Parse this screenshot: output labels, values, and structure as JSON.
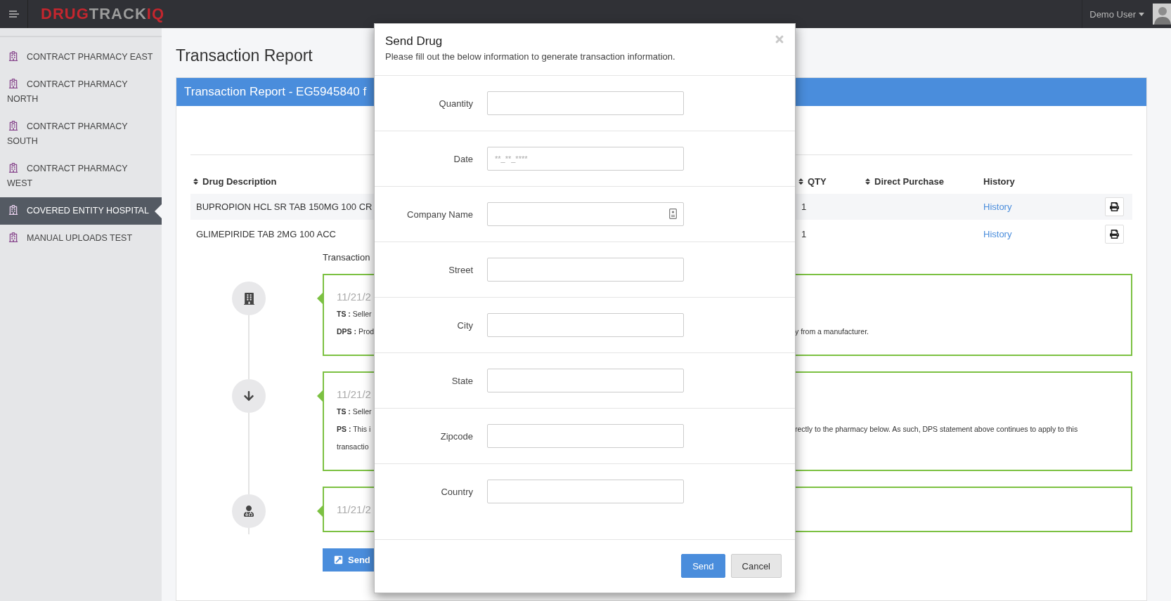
{
  "topbar": {
    "logo": [
      {
        "text": "DRUG",
        "color": "#c4262e"
      },
      {
        "text": "TRACK",
        "color": "#9b9b9b"
      },
      {
        "text": "IQ",
        "color": "#c4262e"
      }
    ],
    "user": "Demo User"
  },
  "sidebar": {
    "items": [
      {
        "label": "CONTRACT PHARMACY EAST",
        "selected": false
      },
      {
        "label": "CONTRACT PHARMACY NORTH",
        "selected": false
      },
      {
        "label": "CONTRACT PHARMACY SOUTH",
        "selected": false
      },
      {
        "label": "CONTRACT PHARMACY WEST",
        "selected": false
      },
      {
        "label": "COVERED ENTITY HOSPITAL",
        "selected": true
      },
      {
        "label": "MANUAL UPLOADS TEST",
        "selected": false
      }
    ]
  },
  "page": {
    "title": "Transaction Report",
    "panel_title": "Transaction Report - EG5945840 f"
  },
  "table": {
    "columns": [
      {
        "label": "Drug Description",
        "sortable": true
      },
      {
        "label": "QTY",
        "sortable": true
      },
      {
        "label": "Direct Purchase",
        "sortable": true
      },
      {
        "label": "History",
        "sortable": false
      }
    ],
    "rows": [
      {
        "drug": "BUPROPION HCL SR TAB 150MG 100 CR",
        "qty": "1",
        "history": "History"
      },
      {
        "drug": "GLIMEPIRIDE TAB 2MG 100 ACC",
        "qty": "1",
        "history": "History"
      }
    ]
  },
  "timeline": {
    "label": "Transaction",
    "events": [
      {
        "kind": "building",
        "date": "11/21/2",
        "lines": [
          {
            "text": "**TS :** Seller"
          },
          {
            "text": "**DPS :** Prod",
            "tail": "y from a manufacturer."
          }
        ]
      },
      {
        "kind": "arrow",
        "date": "11/21/2",
        "lines": [
          {
            "text": "**TS :** Seller"
          },
          {
            "text": "**PS :** This i",
            "tail": "rectly to the pharmacy below. As such, DPS statement above continues to apply to this"
          },
          {
            "text": "transactio"
          }
        ]
      },
      {
        "kind": "doctor",
        "date": "11/21/2"
      }
    ]
  },
  "send_button": "Send",
  "modal": {
    "title": "Send Drug",
    "subtitle": "Please fill out the below information to generate transaction information.",
    "fields": [
      {
        "label": "Quantity",
        "kind": "text"
      },
      {
        "label": "Date",
        "kind": "text",
        "placeholder": "**_**_****"
      },
      {
        "label": "Company Name",
        "kind": "contact"
      },
      {
        "label": "Street",
        "kind": "text"
      },
      {
        "label": "City",
        "kind": "text"
      },
      {
        "label": "State",
        "kind": "text"
      },
      {
        "label": "Zipcode",
        "kind": "text"
      },
      {
        "label": "Country",
        "kind": "text"
      }
    ],
    "buttons": [
      {
        "label": "Send",
        "kind": "primary"
      },
      {
        "label": "Cancel",
        "kind": "default"
      }
    ]
  }
}
